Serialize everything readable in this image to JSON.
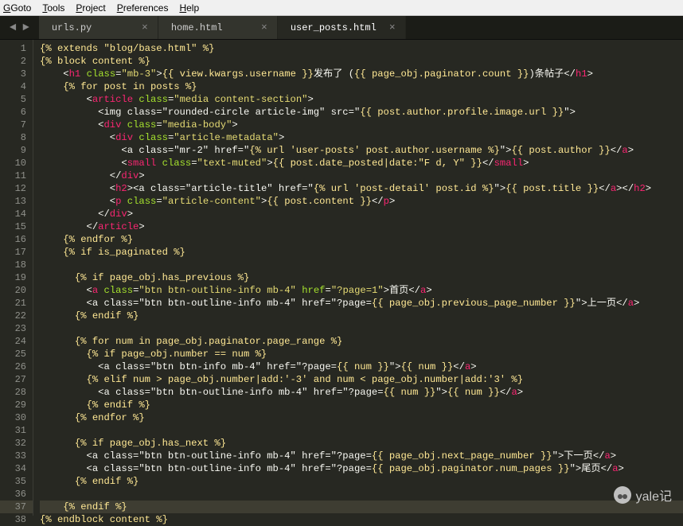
{
  "menu": {
    "goto": "Goto",
    "tools": "Tools",
    "project": "Project",
    "preferences": "Preferences",
    "help": "Help"
  },
  "tabs": [
    {
      "label": "urls.py",
      "active": false
    },
    {
      "label": "home.html",
      "active": false
    },
    {
      "label": "user_posts.html",
      "active": true
    }
  ],
  "watermark": "yale记",
  "highlighted_line": 37,
  "code_lines": [
    "{% extends \"blog/base.html\" %}",
    "{% block content %}",
    "    <h1 class=\"mb-3\">{{ view.kwargs.username }}发布了 ({{ page_obj.paginator.count }})条帖子</h1>",
    "    {% for post in posts %}",
    "        <article class=\"media content-section\">",
    "          <img class=\"rounded-circle article-img\" src=\"{{ post.author.profile.image.url }}\">",
    "          <div class=\"media-body\">",
    "            <div class=\"article-metadata\">",
    "              <a class=\"mr-2\" href=\"{% url 'user-posts' post.author.username %}\">{{ post.author }}</a>",
    "              <small class=\"text-muted\">{{ post.date_posted|date:\"F d, Y\" }}</small>",
    "            </div>",
    "            <h2><a class=\"article-title\" href=\"{% url 'post-detail' post.id %}\">{{ post.title }}</a></h2>",
    "            <p class=\"article-content\">{{ post.content }}</p>",
    "          </div>",
    "        </article>",
    "    {% endfor %}",
    "    {% if is_paginated %}",
    "",
    "      {% if page_obj.has_previous %}",
    "        <a class=\"btn btn-outline-info mb-4\" href=\"?page=1\">首页</a>",
    "        <a class=\"btn btn-outline-info mb-4\" href=\"?page={{ page_obj.previous_page_number }}\">上一页</a>",
    "      {% endif %}",
    "",
    "      {% for num in page_obj.paginator.page_range %}",
    "        {% if page_obj.number == num %}",
    "          <a class=\"btn btn-info mb-4\" href=\"?page={{ num }}\">{{ num }}</a>",
    "        {% elif num > page_obj.number|add:'-3' and num < page_obj.number|add:'3' %}",
    "          <a class=\"btn btn-outline-info mb-4\" href=\"?page={{ num }}\">{{ num }}</a>",
    "        {% endif %}",
    "      {% endfor %}",
    "",
    "      {% if page_obj.has_next %}",
    "        <a class=\"btn btn-outline-info mb-4\" href=\"?page={{ page_obj.next_page_number }}\">下一页</a>",
    "        <a class=\"btn btn-outline-info mb-4\" href=\"?page={{ page_obj.paginator.num_pages }}\">尾页</a>",
    "      {% endif %}",
    "",
    "    {% endif %}",
    "{% endblock content %}"
  ]
}
